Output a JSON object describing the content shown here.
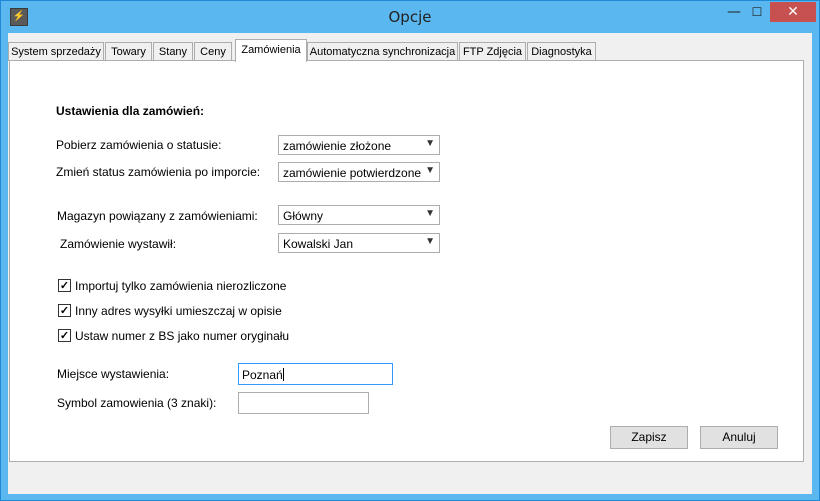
{
  "window": {
    "title": "Opcje",
    "app_icon": "app-icon",
    "minimize_glyph": "—",
    "maximize_glyph": "☐",
    "close_glyph": "✕"
  },
  "tabs": [
    {
      "label": "System sprzedaży"
    },
    {
      "label": "Towary"
    },
    {
      "label": "Stany"
    },
    {
      "label": "Ceny"
    },
    {
      "label": "Zamówienia",
      "active": true
    },
    {
      "label": "Automatyczna synchronizacja"
    },
    {
      "label": "FTP Zdjęcia"
    },
    {
      "label": "Diagnostyka"
    }
  ],
  "orders": {
    "section_title": "Ustawienia dla zamówień:",
    "fetch_status_label": "Pobierz zamówienia o statusie:",
    "fetch_status_value": "zamówienie złożone",
    "change_status_label": "Zmień status zamówienia po imporcie:",
    "change_status_value": "zamówienie potwierdzone",
    "warehouse_label": "Magazyn powiązany z zamówieniami:",
    "warehouse_value": "Główny",
    "issuer_label": "Zamówienie wystawił:",
    "issuer_value": "Kowalski Jan",
    "checkboxes": [
      {
        "label": "Importuj tylko zamówienia nierozliczone",
        "checked": true
      },
      {
        "label": "Inny adres wysyłki umieszczaj w opisie",
        "checked": true
      },
      {
        "label": "Ustaw numer z BS jako numer oryginału",
        "checked": true
      }
    ],
    "place_label": "Miejsce wystawienia:",
    "place_value": "Poznań",
    "symbol_label": "Symbol zamowienia (3 znaki):",
    "symbol_value": ""
  },
  "buttons": {
    "save": "Zapisz",
    "cancel": "Anuluj"
  },
  "colors": {
    "title_bar": "#5bb7ef",
    "close_button": "#c75050",
    "focus_border": "#3399ff"
  }
}
